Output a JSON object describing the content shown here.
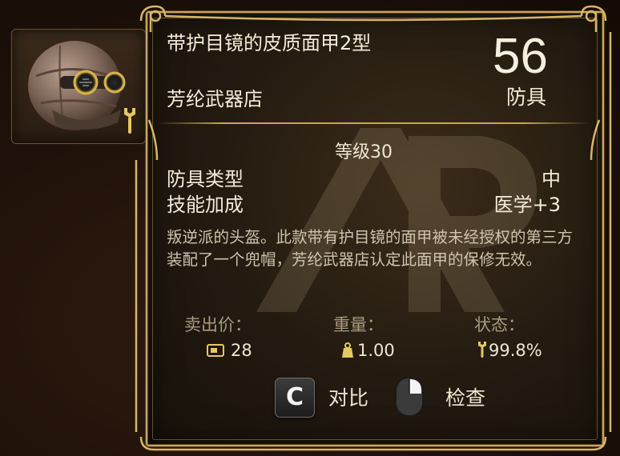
{
  "item": {
    "name": "带护目镜的皮质面甲2型",
    "vendor": "芳纶武器店",
    "armor_value": "56",
    "armor_label": "防具",
    "level": "等级30",
    "stats": [
      {
        "label": "防具类型",
        "value": "中"
      },
      {
        "label": "技能加成",
        "value": "医学+3"
      }
    ],
    "description": "叛逆派的头盔。此款带有护目镜的面甲被未经授权的第三方装配了一个兜帽，芳纶武器店认定此面甲的保修无效。",
    "sell_price": {
      "label": "卖出价：",
      "value": "28",
      "icon": "caps-icon"
    },
    "weight": {
      "label": "重量：",
      "value": "1.00",
      "icon": "weight-icon"
    },
    "condition": {
      "label": "状态：",
      "value": "99.8%",
      "icon": "wrench-icon",
      "percent": 99.8
    }
  },
  "actions": {
    "compare_key": "C",
    "compare_label": "对比",
    "inspect_icon": "mouse-icon",
    "inspect_label": "检查"
  },
  "colors": {
    "frame_gold": "#c8a45a",
    "text_primary": "#f4ecd8",
    "text_muted": "#a89a80"
  }
}
